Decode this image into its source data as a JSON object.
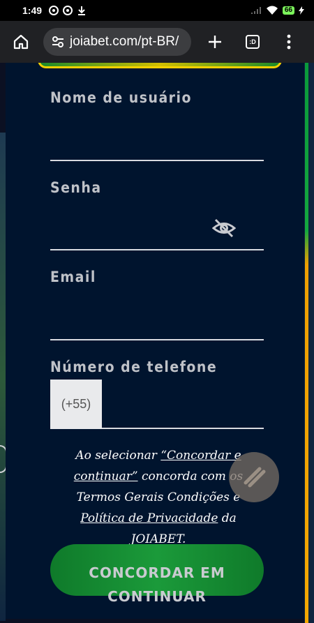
{
  "status_bar": {
    "time": "1:49",
    "battery": "66"
  },
  "browser": {
    "url": "joiabet.com/pt-BR/",
    "tabs_label": ":D"
  },
  "form": {
    "username_label": "Nome de usuário",
    "password_label": "Senha",
    "email_label": "Email",
    "phone_label": "Número de telefone",
    "phone_prefix": "(+55)"
  },
  "terms": {
    "prefix": "Ao selecionar ",
    "link_agree": "“Concordar e continuar”",
    "middle": " concorda com os Termos Gerais Condições e ",
    "link_privacy": "Política de Privacidade",
    "suffix": " da JOIABET."
  },
  "cta": {
    "label": "CONCORDAR EM\nCONTINUAR"
  },
  "colors": {
    "modal_bg": "#00142e",
    "cta_green": "#1b9a3a",
    "accent_yellow": "#f5d000"
  }
}
